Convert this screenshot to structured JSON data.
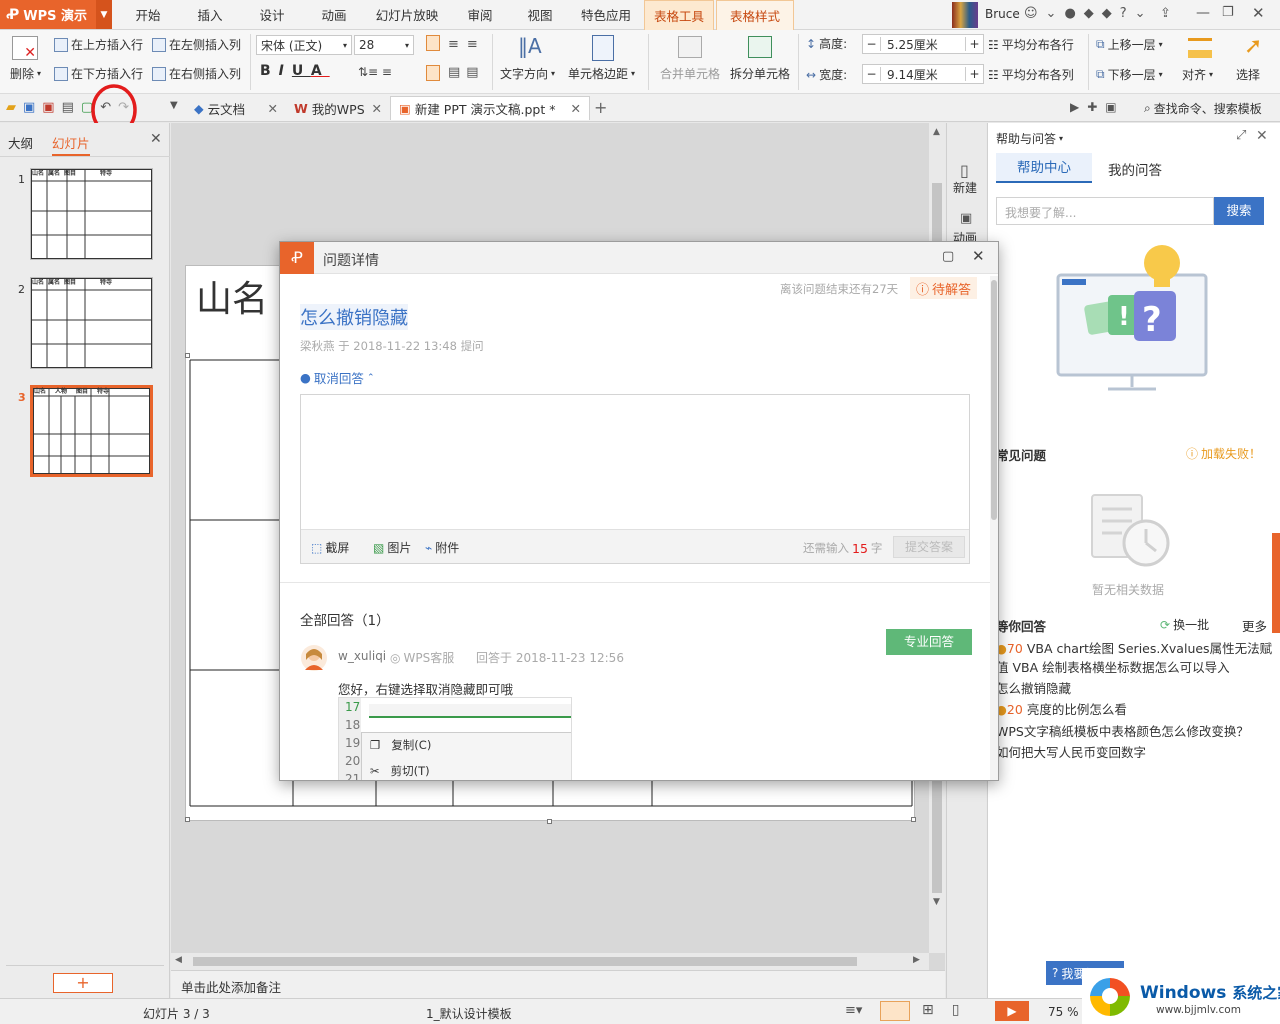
{
  "app": {
    "name": "WPS 演示",
    "user": "Bruce"
  },
  "menu": {
    "tabs": [
      "开始",
      "插入",
      "设计",
      "动画",
      "幻灯片放映",
      "审阅",
      "视图",
      "特色应用",
      "表格工具",
      "表格样式"
    ]
  },
  "ribbon": {
    "delete_label": "删除",
    "insert_above": "在上方插入行",
    "insert_left": "在左侧插入列",
    "insert_below": "在下方插入行",
    "insert_right": "在右侧插入列",
    "font": "宋体 (正文)",
    "font_size": "28",
    "text_direction": "文字方向",
    "cell_margin": "单元格边距",
    "merge": "合并单元格",
    "split": "拆分单元格",
    "height_label": "高度:",
    "height_value": "5.25厘米",
    "width_label": "宽度:",
    "width_value": "9.14厘米",
    "distribute_rows": "平均分布各行",
    "distribute_cols": "平均分布各列",
    "bring_forward": "上移一层",
    "send_backward": "下移一层",
    "align": "对齐",
    "select": "选择"
  },
  "doctabs": {
    "cloud": "云文档",
    "mywps": "我的WPS",
    "current": "新建 PPT 演示文稿.ppt *",
    "search": "查找命令、搜索模板"
  },
  "left": {
    "tab_outline": "大纲",
    "tab_slides": "幻灯片",
    "slide_numbers": [
      "1",
      "2",
      "3"
    ],
    "thumb_h1": "山名",
    "thumb_h2": "属名",
    "thumb_h3": "图目",
    "thumb_h4": "特寺",
    "thumb3_h2": "人物"
  },
  "slide": {
    "title_text": "山名",
    "notes_placeholder": "单击此处添加备注"
  },
  "rightstrip": {
    "new": "新建",
    "anim": "动画"
  },
  "help": {
    "title": "帮助与问答",
    "tab_help": "帮助中心",
    "tab_my": "我的问答",
    "search_placeholder": "我想要了解...",
    "search_button": "搜索",
    "faq_title": "常见问题",
    "faq_error": "加载失败！",
    "no_data": "暂无相关数据",
    "answer_title": "等你回答",
    "refresh": "换一批",
    "more": "更多",
    "questions": [
      {
        "score": "70",
        "text": "VBA chart绘图 Series.Xvalues属性无法赋值 VBA 绘制表格横坐标数据怎么可以导入"
      },
      {
        "score": "",
        "text": "怎么撤销隐藏"
      },
      {
        "score": "20",
        "text": "亮度的比例怎么看"
      },
      {
        "score": "",
        "text": "WPS文字稿纸模板中表格颜色怎么修改变换？"
      },
      {
        "score": "",
        "text": "如何把大写人民币变回数字"
      }
    ],
    "ask_button": "我要提问"
  },
  "dialog": {
    "title": "问题详情",
    "days_left": "离该问题结束还有27天",
    "status": "待解答",
    "question": "怎么撤销隐藏",
    "meta": "梁秋燕 于 2018-11-22 13:48 提问",
    "cancel_answer": "取消回答",
    "tool_screenshot": "截屏",
    "tool_image": "图片",
    "tool_attach": "附件",
    "remain_prefix": "还需输入",
    "remain_count": "15",
    "remain_suffix": "字",
    "submit": "提交答案",
    "all_answers": "全部回答（1）",
    "pro_answer": "专业回答",
    "answer_user": "w_xuliqi",
    "answer_badge": "WPS客服",
    "answer_time": "回答于 2018-11-23 12:56",
    "answer_text": "您好，右键选择取消隐藏即可哦",
    "shot_rows": [
      "17",
      "18",
      "19",
      "20",
      "21"
    ],
    "shot_copy": "复制(C)",
    "shot_cut": "剪切(T)"
  },
  "statusbar": {
    "slide_info": "幻灯片 3 / 3",
    "template": "1_默认设计模板",
    "zoom": "75 %"
  },
  "watermark": {
    "brand": "Windows",
    "cn": "系统之家",
    "url": "www.bjjmlv.com"
  },
  "colors": {
    "accent": "#e8642b",
    "link": "#3b73c5",
    "green": "#5fb878",
    "annotation": "#e31c1c"
  }
}
